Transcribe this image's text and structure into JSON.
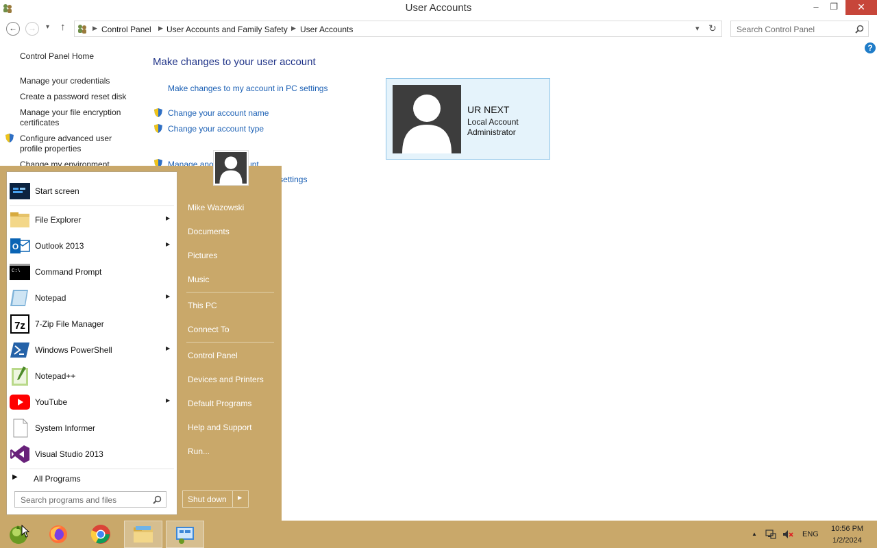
{
  "window": {
    "title": "User Accounts",
    "controls": {
      "minimize": "‒",
      "maximize": "❐",
      "close": "✕"
    }
  },
  "nav": {
    "back": "←",
    "forward": "→",
    "recent": "▾",
    "up": "↑",
    "refresh": "↻",
    "dropdown": "▾",
    "breadcrumb": [
      "Control Panel",
      "User Accounts and Family Safety",
      "User Accounts"
    ],
    "search_placeholder": "Search Control Panel"
  },
  "sidebar": {
    "home": "Control Panel Home",
    "links": [
      "Manage your credentials",
      "Create a password reset disk",
      "Manage your file encryption certificates",
      "Configure advanced user profile properties",
      "Change my environment"
    ]
  },
  "main": {
    "heading": "Make changes to your user account",
    "links": {
      "pc_settings": "Make changes to my account in PC settings",
      "change_name": "Change your account name",
      "change_type": "Change your account type",
      "manage_other": "Manage another account",
      "uac_settings": "Change User Account Control settings"
    },
    "help": "?"
  },
  "account": {
    "name": "UR NEXT",
    "type": "Local Account",
    "role": "Administrator"
  },
  "start_menu": {
    "pinned": [
      {
        "label": "Start screen",
        "icon": "start-screen-icon",
        "submenu": false
      },
      {
        "label": "File Explorer",
        "icon": "folder-icon",
        "submenu": true
      },
      {
        "label": "Outlook 2013",
        "icon": "outlook-icon",
        "submenu": true
      },
      {
        "label": "Command Prompt",
        "icon": "cmd-icon",
        "submenu": false
      },
      {
        "label": "Notepad",
        "icon": "notepad-icon",
        "submenu": true
      },
      {
        "label": "7-Zip File Manager",
        "icon": "7zip-icon",
        "submenu": false
      },
      {
        "label": "Windows PowerShell",
        "icon": "powershell-icon",
        "submenu": true
      },
      {
        "label": "Notepad++",
        "icon": "notepadpp-icon",
        "submenu": false
      },
      {
        "label": "YouTube",
        "icon": "youtube-icon",
        "submenu": true
      },
      {
        "label": "System Informer",
        "icon": "document-icon",
        "submenu": false
      },
      {
        "label": "Visual Studio 2013",
        "icon": "visual-studio-icon",
        "submenu": false
      }
    ],
    "submenu_arrow": "▶",
    "all_programs": "All Programs",
    "all_programs_arrow": "▶",
    "search_placeholder": "Search programs and files",
    "right": {
      "user": "Mike Wazowski",
      "documents": "Documents",
      "pictures": "Pictures",
      "music": "Music",
      "this_pc": "This PC",
      "connect_to": "Connect To",
      "control_panel": "Control Panel",
      "devices": "Devices and Printers",
      "defaults": "Default Programs",
      "help": "Help and Support",
      "run": "Run..."
    },
    "shutdown": "Shut down",
    "shutdown_arrow": "▶"
  },
  "taskbar": {
    "apps": [
      "start-orb-icon",
      "firefox-icon",
      "chrome-icon",
      "file-explorer-icon",
      "control-panel-icon"
    ],
    "tray": {
      "chevron": "▲",
      "language": "ENG",
      "time": "10:56 PM",
      "date": "1/2/2024"
    }
  },
  "colors": {
    "accent": "#c9a86a",
    "link": "#1a5fb4",
    "heading": "#1e3287",
    "card_bg": "#e5f3fb",
    "close_btn": "#c7463a"
  }
}
